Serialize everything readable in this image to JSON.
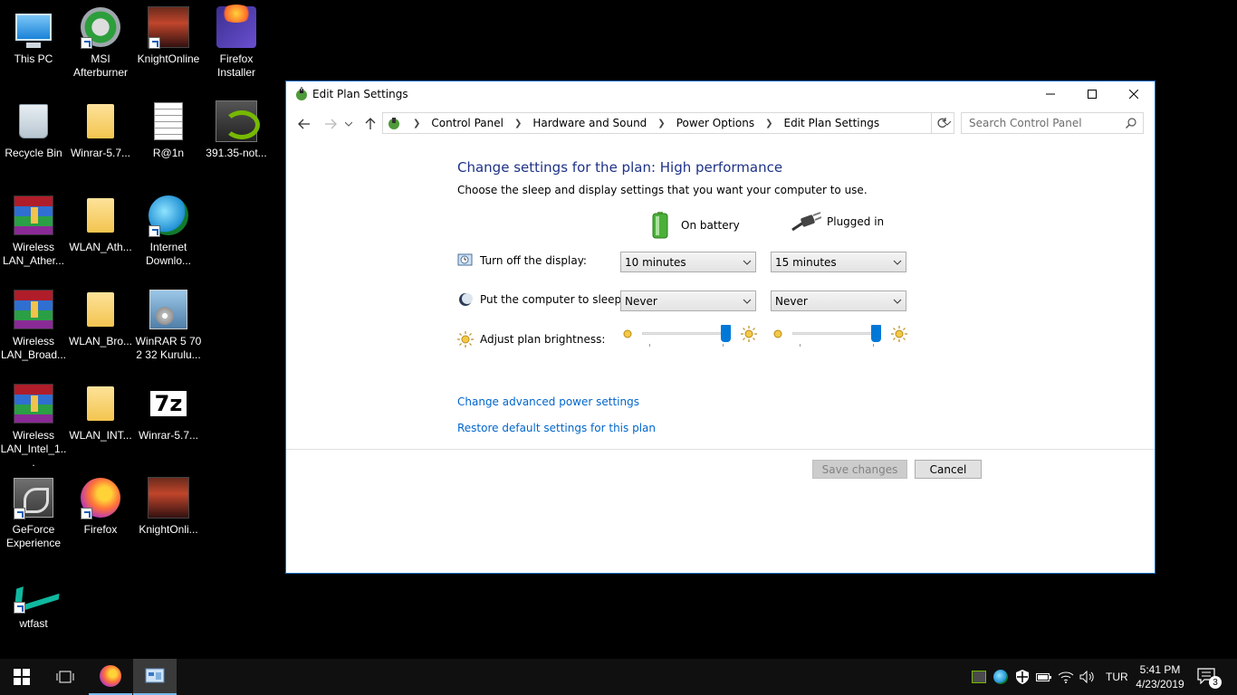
{
  "desktop": {
    "icons": [
      {
        "label": "This PC",
        "icon": "this-pc-icon"
      },
      {
        "label": "MSI Afterburner",
        "icon": "msi-afterburner-icon"
      },
      {
        "label": "KnightOnline",
        "icon": "knightonline-icon"
      },
      {
        "label": "Firefox Installer",
        "icon": "firefox-installer-icon"
      },
      {
        "label": "Recycle Bin",
        "icon": "recycle-bin-icon"
      },
      {
        "label": "Winrar-5.7...",
        "icon": "folder-icon"
      },
      {
        "label": "R@1n",
        "icon": "text-document-icon"
      },
      {
        "label": "391.35-not...",
        "icon": "nvidia-icon"
      },
      {
        "label": "Wireless LAN_Ather...",
        "icon": "winrar-archive-icon"
      },
      {
        "label": "WLAN_Ath...",
        "icon": "folder-icon"
      },
      {
        "label": "Internet Downlo...",
        "icon": "idm-icon"
      },
      {
        "label": "Wireless LAN_Broad...",
        "icon": "winrar-archive-icon"
      },
      {
        "label": "WLAN_Bro...",
        "icon": "folder-icon"
      },
      {
        "label": "WinRAR 5 70 2 32 Kurulu...",
        "icon": "winrar-installer-icon"
      },
      {
        "label": "Wireless LAN_Intel_1...",
        "icon": "winrar-archive-icon"
      },
      {
        "label": "WLAN_INT...",
        "icon": "folder-icon"
      },
      {
        "label": "Winrar-5.7...",
        "icon": "7zip-icon"
      },
      {
        "label": "GeForce Experience",
        "icon": "geforce-experience-icon"
      },
      {
        "label": "Firefox",
        "icon": "firefox-icon"
      },
      {
        "label": "KnightOnli...",
        "icon": "knightonline-icon"
      },
      {
        "label": "wtfast",
        "icon": "wtfast-icon"
      }
    ]
  },
  "window": {
    "title": "Edit Plan Settings",
    "breadcrumb": [
      "Control Panel",
      "Hardware and Sound",
      "Power Options",
      "Edit Plan Settings"
    ],
    "search_placeholder": "Search Control Panel",
    "heading": "Change settings for the plan: High performance",
    "subheading": "Choose the sleep and display settings that you want your computer to use.",
    "columns": {
      "battery": "On battery",
      "plugged": "Plugged in"
    },
    "rows": {
      "display_label": "Turn off the display:",
      "display_battery": "10 minutes",
      "display_plugged": "15 minutes",
      "sleep_label": "Put the computer to sleep:",
      "sleep_battery": "Never",
      "sleep_plugged": "Never",
      "brightness_label": "Adjust plan brightness:",
      "brightness_battery": 1.0,
      "brightness_plugged": 1.0
    },
    "links": {
      "advanced": "Change advanced power settings",
      "restore": "Restore default settings for this plan"
    },
    "buttons": {
      "save": "Save changes",
      "cancel": "Cancel"
    }
  },
  "taskbar": {
    "language": "TUR",
    "time": "5:41 PM",
    "date": "4/23/2019",
    "notification_count": "3"
  },
  "colors": {
    "accent": "#0078d7",
    "heading": "#1e3287",
    "link": "#0066cc",
    "window_border": "#1b6cc3"
  }
}
